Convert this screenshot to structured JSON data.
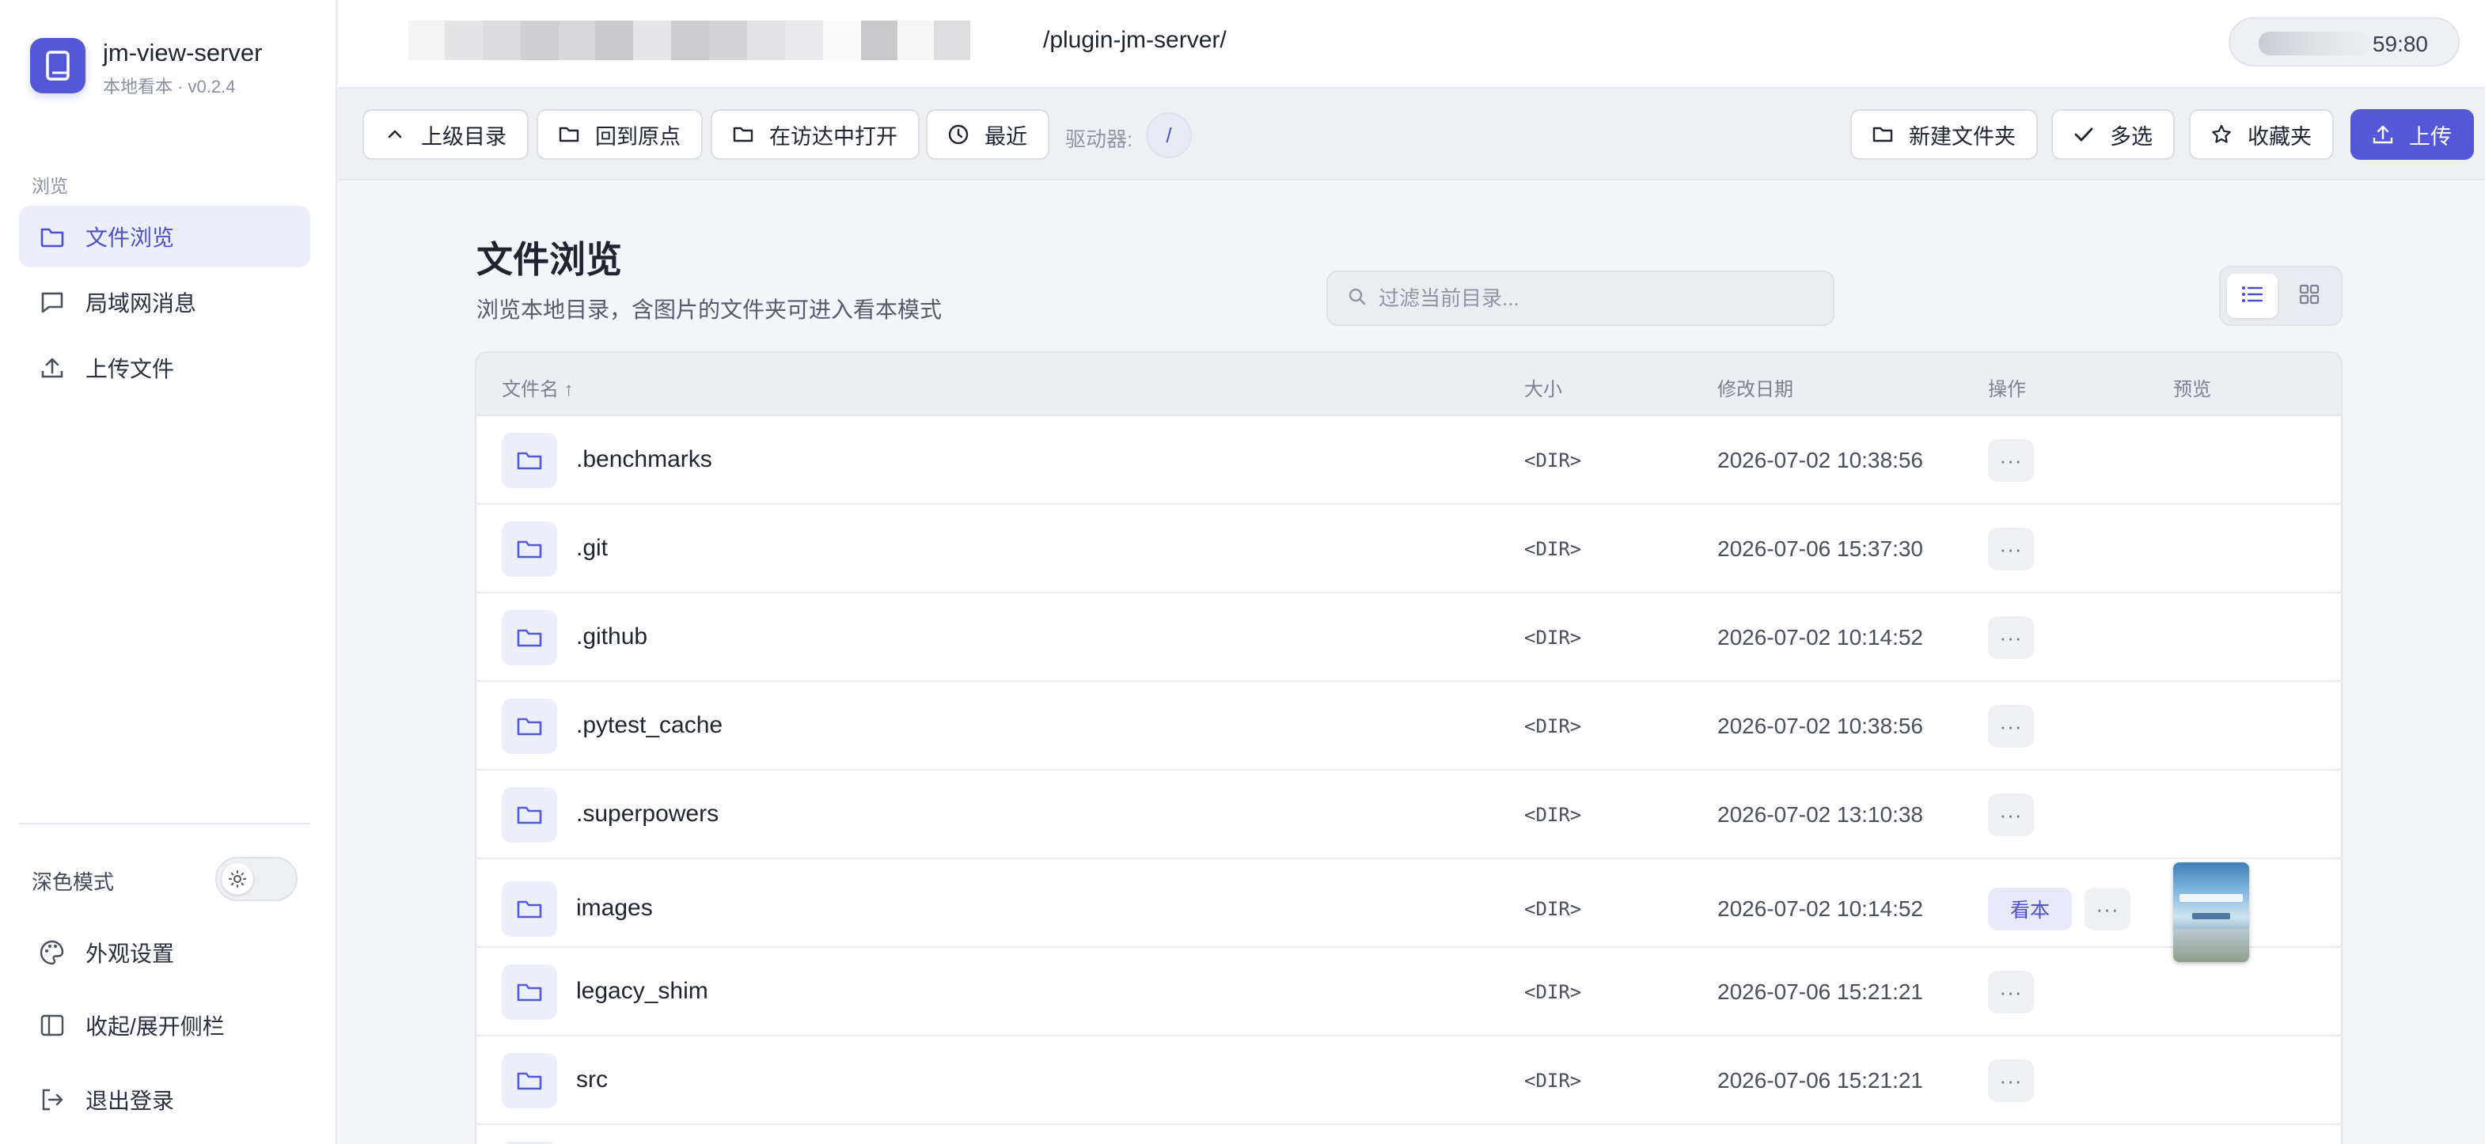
{
  "sidebar": {
    "app_name": "jm-view-server",
    "app_sub": "本地看本 · v0.2.4",
    "section_label": "浏览",
    "items": [
      {
        "label": "文件浏览",
        "icon": "folder-icon",
        "active": true
      },
      {
        "label": "局域网消息",
        "icon": "message-icon",
        "active": false
      },
      {
        "label": "上传文件",
        "icon": "upload-icon",
        "active": false
      }
    ],
    "dark_mode_label": "深色模式",
    "bottom_links": [
      {
        "label": "外观设置",
        "icon": "palette-icon"
      },
      {
        "label": "收起/展开侧栏",
        "icon": "sidebar-toggle-icon"
      },
      {
        "label": "退出登录",
        "icon": "logout-icon"
      }
    ]
  },
  "topbar": {
    "path_suffix": "/plugin-jm-server/",
    "server_suffix": "59:80"
  },
  "toolbar": {
    "up_label": "上级目录",
    "home_label": "回到原点",
    "finder_label": "在访达中打开",
    "recent_label": "最近",
    "drive_label": "驱动器:",
    "drive_value": "/",
    "new_folder_label": "新建文件夹",
    "multi_select_label": "多选",
    "favorites_label": "收藏夹",
    "upload_label": "上传"
  },
  "main": {
    "title": "文件浏览",
    "subtitle": "浏览本地目录，含图片的文件夹可进入看本模式",
    "search_placeholder": "过滤当前目录...",
    "columns": {
      "name": "文件名 ↑",
      "size": "大小",
      "modified": "修改日期",
      "actions": "操作",
      "preview": "预览"
    },
    "rows": [
      {
        "name": ".benchmarks",
        "size": "<DIR>",
        "modified": "2026-07-02 10:38:56",
        "more": "···"
      },
      {
        "name": ".git",
        "size": "<DIR>",
        "modified": "2026-07-06 15:37:30",
        "more": "···"
      },
      {
        "name": ".github",
        "size": "<DIR>",
        "modified": "2026-07-02 10:14:52",
        "more": "···"
      },
      {
        "name": ".pytest_cache",
        "size": "<DIR>",
        "modified": "2026-07-02 10:38:56",
        "more": "···"
      },
      {
        "name": ".superpowers",
        "size": "<DIR>",
        "modified": "2026-07-02 13:10:38",
        "more": "···"
      },
      {
        "name": "images",
        "size": "<DIR>",
        "modified": "2026-07-02 10:14:52",
        "read_label": "看本",
        "more": "···",
        "has_preview": true
      },
      {
        "name": "legacy_shim",
        "size": "<DIR>",
        "modified": "2026-07-06 15:21:21",
        "more": "···"
      },
      {
        "name": "src",
        "size": "<DIR>",
        "modified": "2026-07-06 15:21:21",
        "more": "···"
      }
    ]
  },
  "colors": {
    "accent": "#5458d6",
    "accent_soft": "#eceefb",
    "page_bg": "#f3f5f8"
  }
}
